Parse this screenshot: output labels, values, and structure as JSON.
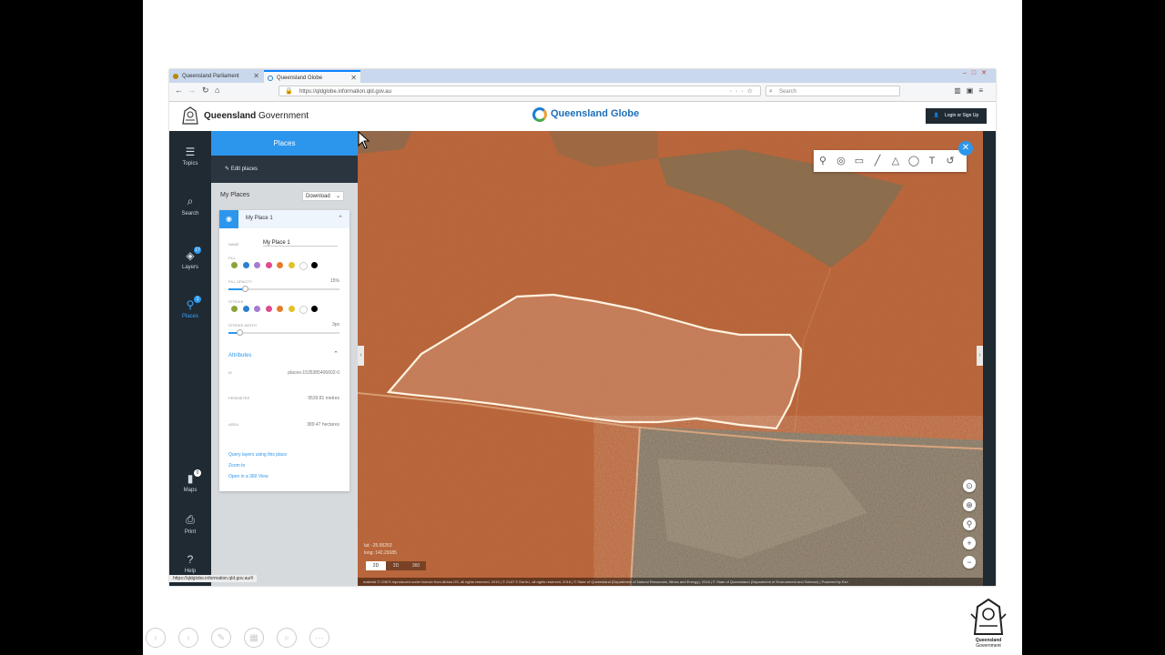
{
  "browser": {
    "tabs": [
      {
        "title": "Queensland Parliament",
        "active": false
      },
      {
        "title": "Queensland Globe",
        "active": true
      }
    ],
    "url": "https://qldglobe.information.qld.gov.au",
    "search_placeholder": "Search",
    "status_url": "https://qldglobe.information.qld.gov.au/#"
  },
  "header": {
    "gov_brand_bold": "Queensland",
    "gov_brand_rest": " Government",
    "app_title": "Queensland Globe",
    "login_label": "Login or Sign Up"
  },
  "rail": {
    "items": [
      {
        "label": "Topics",
        "icon": "layers-stack-icon"
      },
      {
        "label": "Search",
        "icon": "search-icon"
      },
      {
        "label": "Layers",
        "icon": "layers-icon",
        "badge": "17"
      },
      {
        "label": "Places",
        "icon": "place-pin-icon",
        "badge": "1",
        "active": true
      },
      {
        "label": "Maps",
        "icon": "book-icon",
        "badge": "0"
      },
      {
        "label": "Print",
        "icon": "printer-icon"
      },
      {
        "label": "Help",
        "icon": "help-icon"
      }
    ]
  },
  "panel": {
    "title": "Places",
    "edit_label": "Edit places",
    "my_places_label": "My Places",
    "download_label": "Download",
    "place": {
      "header_name": "My Place 1",
      "name_label": "NAME",
      "name_value": "My Place 1",
      "fill_label": "FILL",
      "fill_opacity_label": "FILL OPACITY",
      "fill_opacity_value": "15%",
      "fill_opacity": 0.15,
      "stroke_label": "STROKE",
      "stroke_width_label": "STROKE WIDTH",
      "stroke_width_value": "3px",
      "stroke_width_level": 0.1,
      "swatch_colors": [
        "#8aa33a",
        "#2c7fd0",
        "#a57cd1",
        "#e14b8c",
        "#e57b2c",
        "#e2c12a",
        "#ffffff",
        "#000000"
      ],
      "attributes_label": "Attributes",
      "attributes": [
        {
          "key": "ID",
          "value": "places-1535385406602-0"
        },
        {
          "key": "PERIMETER",
          "value": "9539.81 metres"
        },
        {
          "key": "AREA",
          "value": "389.47 hectares"
        }
      ],
      "links": [
        "Query layers using this place",
        "Zoom to",
        "Open in a 360 View"
      ]
    }
  },
  "map": {
    "coords_line1": "lat: -25.95253",
    "coords_line2": "long: 142.29185",
    "modes": [
      "2D",
      "3D",
      "360"
    ],
    "active_mode": "2D",
    "attribution": "material © CNES reproduced under licence from Airbus DS, all rights reserved, 2015 | © 21AT © Earth-i, all rights reserved, 2016 | © State of Queensland (Department of Natural Resources, Mines and Energy), 2018 | © State of Queensland (Department of Environment and Science) | Powered by Esri",
    "draw_tools": [
      "point-icon",
      "pin-icon",
      "rectangle-icon",
      "line-icon",
      "polygon-icon",
      "circle-icon",
      "text-icon",
      "undo-icon"
    ],
    "zoom_controls": [
      "compass-icon",
      "locate-icon",
      "location-icon",
      "zoom-in-icon",
      "zoom-out-icon"
    ],
    "colors": {
      "ground": "#c0643a",
      "scrub": "#7a7458",
      "polygon_stroke": "#fff3e0"
    }
  },
  "footer": {
    "qg_corner_line1": "Queensland",
    "qg_corner_line2": "Government"
  }
}
